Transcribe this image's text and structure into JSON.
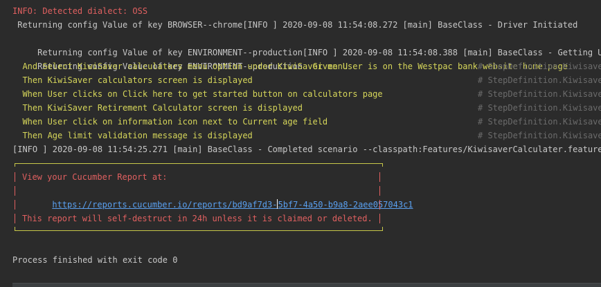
{
  "console": {
    "partial_top": "-- ~~~~~~ ~~ ~~ ~~~~~~ ~~~~~~~ ~~",
    "lines": [
      {
        "text": "INFO: Detected dialect: OSS"
      },
      {
        "text": " Returning config Value of key BROWSER--chrome[INFO ] 2020-09-08 11:54:08.272 [main] BaseClass - Driver Initiated"
      },
      {
        "prefix": " Returning config Value of key ENVIRONMENT--production[INFO ] 2020-09-08 11:54:08.388 [main] BaseClass - Getting URL: ",
        "link": "http"
      },
      {
        "prefix": " Returning config Value of key ENVIRONMENT--production  ",
        "step": "Given User is on the Westpac bank website home page"
      },
      {
        "step": "  And Select KiwiSaver calculators menu option under KiwiSaver menu",
        "comment": "# StepDefinition.Kiwisaver"
      },
      {
        "step": "  Then KiwiSaver calculators screen is displayed",
        "comment": "# StepDefinition.Kiwisaver"
      },
      {
        "step": "  When User clicks on Click here to get started button on calculators page",
        "comment": "# StepDefinition.Kiwisaver"
      },
      {
        "step": "  Then KiwiSaver Retirement Calculator screen is displayed",
        "comment": "# StepDefinition.Kiwisaver"
      },
      {
        "step": "  When User click on information icon next to Current age field",
        "comment": "# StepDefinition.Kiwisaver"
      },
      {
        "step": "  Then Age limit validation message is displayed",
        "comment": "# StepDefinition.Kiwisaver"
      },
      {
        "text": "[INFO ] 2020-09-08 11:54:25.271 [main] BaseClass - Completed scenario --classpath:Features/KiwisaverCalculater.feature:4--"
      }
    ],
    "report": {
      "heading": "View your Cucumber Report at:",
      "url_before_cursor": "https://reports.cucumber.io/reports/bd9af7d3-",
      "url_after_cursor": "5bf7-4a50-b9a8-2aee057043c1",
      "warning": "This report will self-destruct in 24h unless it is claimed or deleted."
    },
    "exit_message": "Process finished with exit code 0"
  },
  "colors": {
    "background": "#2b2b2b",
    "error_red": "#e06060",
    "step_yellow": "#d6d65a",
    "link_blue": "#5aa0f0",
    "comment_gray": "#6b6b6b"
  }
}
